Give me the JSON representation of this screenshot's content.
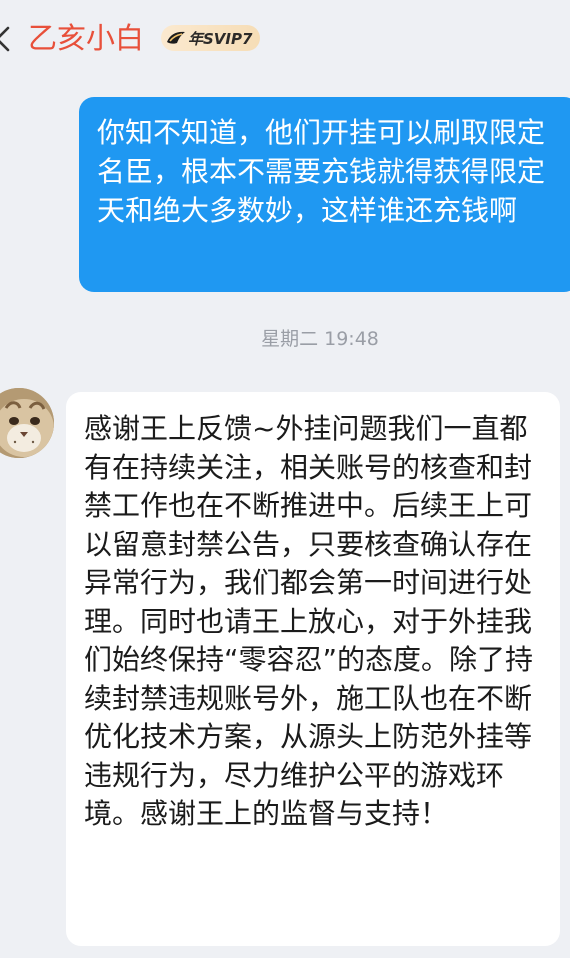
{
  "header": {
    "back_icon": "chevron-left-icon",
    "contact_name": "乙亥小白",
    "vip_badge": {
      "icon": "wing-icon",
      "label": "年SVIP7"
    }
  },
  "messages": [
    {
      "direction": "outgoing",
      "color": "#1f98f2",
      "text": "你知不知道，他们开挂可以刷取限定名臣，根本不需要充钱就得获得限定天和绝大多数妙，这样谁还充钱啊"
    },
    {
      "type": "timestamp",
      "text": "星期二 19:48"
    },
    {
      "direction": "incoming",
      "avatar": "cat-avatar",
      "text": "感谢王上反馈~外挂问题我们一直都有在持续关注，相关账号的核查和封禁工作也在不断推进中。后续王上可以留意封禁公告，只要核查确认存在异常行为，我们都会第一时间进行处理。同时也请王上放心，对于外挂我们始终保持“零容忍”的态度。除了持续封禁违规账号外，施工队也在不断优化技术方案，从源头上防范外挂等违规行为，尽力维护公平的游戏环境。感谢王上的监督与支持！"
    }
  ]
}
